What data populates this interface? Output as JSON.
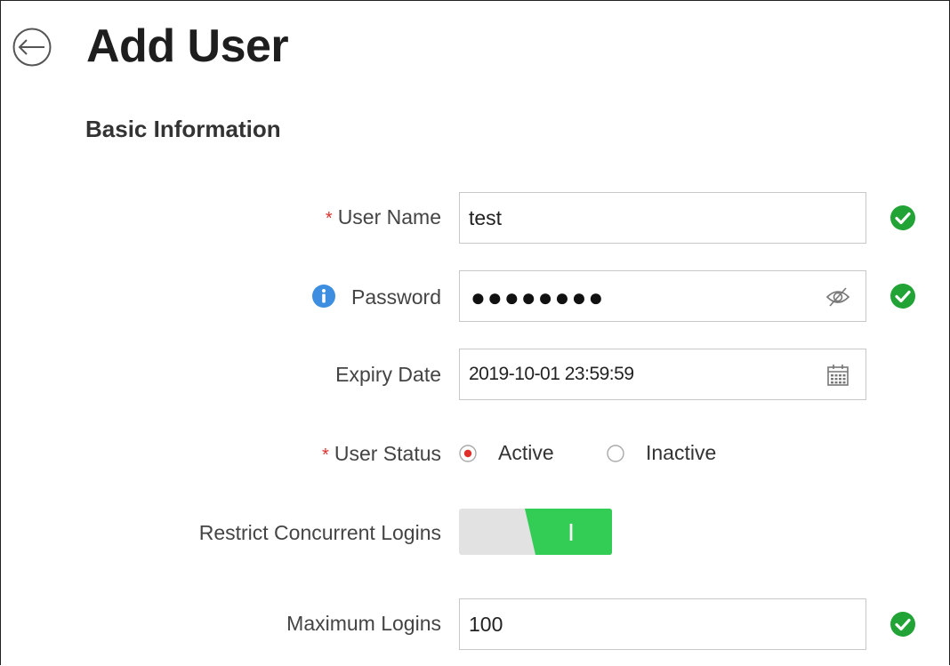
{
  "header": {
    "title": "Add User",
    "back_icon": "arrow-left-circle-icon"
  },
  "section": {
    "title": "Basic Information"
  },
  "form": {
    "user_name": {
      "label": "User Name",
      "required_mark": "*",
      "value": "test",
      "valid": true
    },
    "password": {
      "label": "Password",
      "info_icon": "info-icon",
      "masked_value": "●●●●●●●●",
      "visibility_icon": "eye-hidden-icon",
      "valid": true
    },
    "expiry_date": {
      "label": "Expiry Date",
      "value": "2019-10-01 23:59:59",
      "calendar_icon": "calendar-icon"
    },
    "user_status": {
      "label": "User Status",
      "required_mark": "*",
      "options": [
        "Active",
        "Inactive"
      ],
      "selected": "Active"
    },
    "restrict_logins": {
      "label": "Restrict Concurrent Logins",
      "enabled": true,
      "on_glyph": "I"
    },
    "max_logins": {
      "label": "Maximum Logins",
      "value": "100",
      "valid": true
    }
  },
  "colors": {
    "valid_green": "#21a336",
    "toggle_green": "#33cc55",
    "toggle_off": "#e2e2e2",
    "required_red": "#e0302a",
    "info_blue": "#3d8ee0",
    "radio_dot": "#e0302a"
  }
}
